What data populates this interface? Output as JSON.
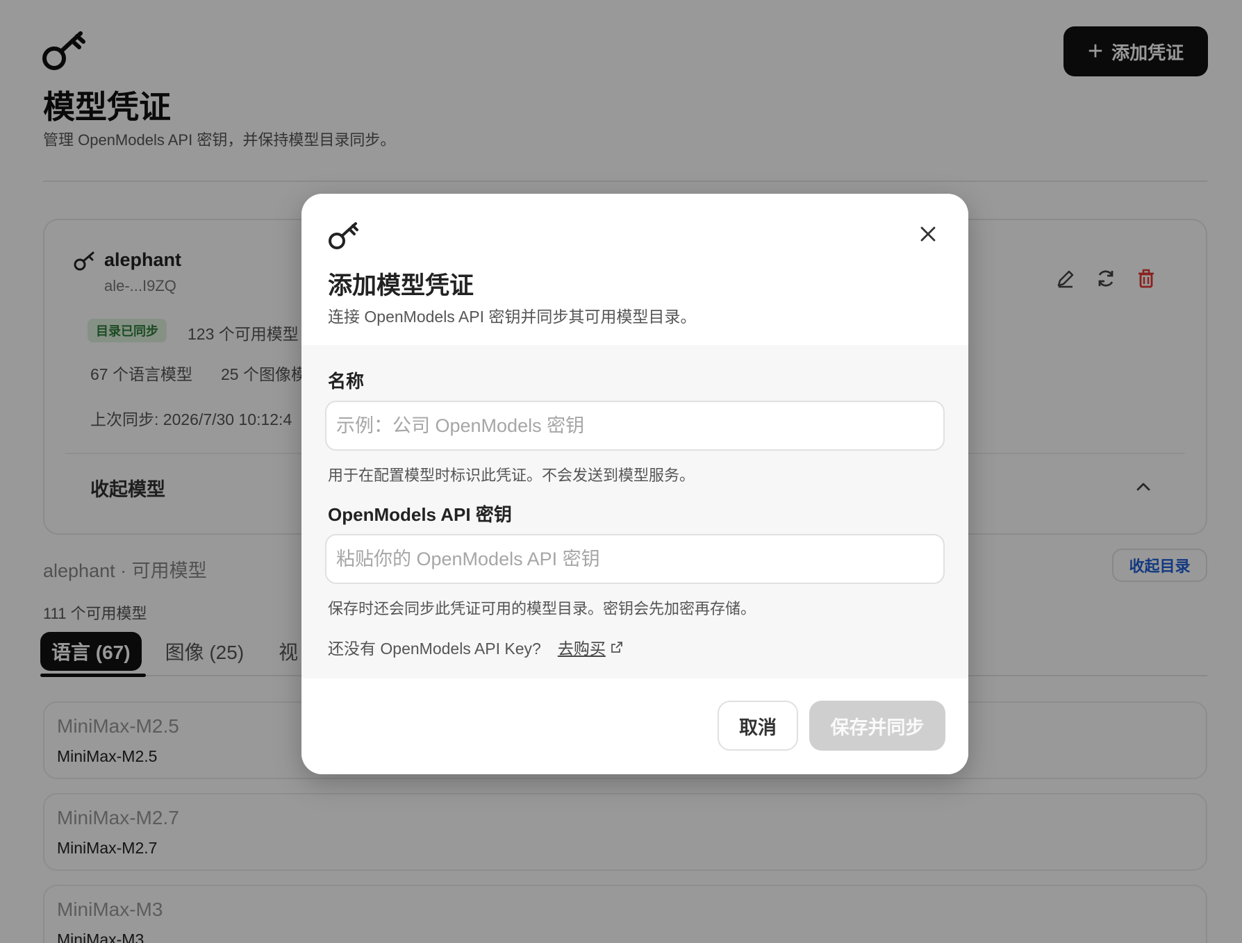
{
  "page": {
    "title": "模型凭证",
    "subtitle": "管理 OpenModels API 密钥，并保持模型目录同步。",
    "add_button_label": "添加凭证"
  },
  "credential_card": {
    "name": "alephant",
    "masked_key": "ale-...I9ZQ",
    "badge": "目录已同步",
    "available_models": "123 个可用模型",
    "language_models": "67 个语言模型",
    "image_models": "25 个图像模",
    "last_sync": "上次同步: 2026/7/30 10:12:4",
    "collapse_label": "收起模型"
  },
  "catalog": {
    "title": "alephant · 可用模型",
    "collapse_button": "收起目录",
    "count": "111 个可用模型",
    "tabs": [
      {
        "label": "语言 (67)",
        "active": true
      },
      {
        "label": "图像 (25)",
        "active": false
      },
      {
        "label": "视",
        "active": false
      }
    ],
    "models": [
      {
        "title": "MiniMax-M2.5",
        "subtitle": "MiniMax-M2.5"
      },
      {
        "title": "MiniMax-M2.7",
        "subtitle": "MiniMax-M2.7"
      },
      {
        "title": "MiniMax-M3",
        "subtitle": "MiniMax-M3"
      }
    ]
  },
  "modal": {
    "title": "添加模型凭证",
    "description": "连接 OpenModels API 密钥并同步其可用模型目录。",
    "name_field": {
      "label": "名称",
      "value": "",
      "placeholder": "示例：公司 OpenModels 密钥",
      "help": "用于在配置模型时标识此凭证。不会发送到模型服务。"
    },
    "key_field": {
      "label": "OpenModels API 密钥",
      "value": "",
      "placeholder": "粘贴你的 OpenModels API 密钥",
      "help": "保存时还会同步此凭证可用的模型目录。密钥会先加密再存储。"
    },
    "no_key_prompt": "还没有 OpenModels API Key?",
    "buy_link": "去购买",
    "cancel_button": "取消",
    "save_button": "保存并同步"
  },
  "colors": {
    "accent_dark": "#111111",
    "badge_bg": "#dff2df",
    "badge_text": "#2d7d3a",
    "link_blue": "#1f5fd6",
    "delete_red": "#e53935",
    "save_disabled": "#cfcfcf"
  },
  "icons": [
    "key-icon",
    "plus-icon",
    "edit-icon",
    "refresh-icon",
    "trash-icon",
    "chevron-up-icon",
    "close-icon",
    "external-link-icon"
  ]
}
